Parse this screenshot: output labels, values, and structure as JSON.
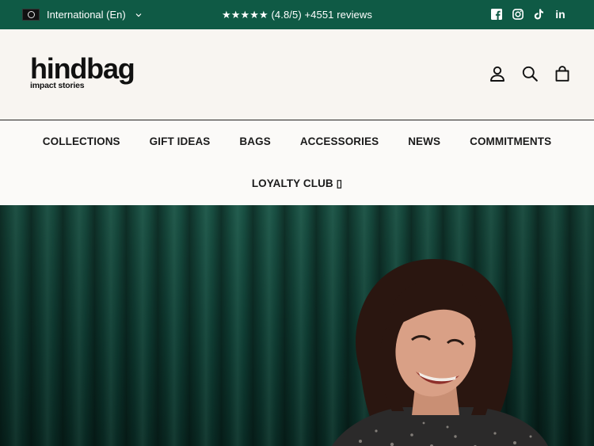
{
  "topbar": {
    "locale_label": "International (En)",
    "reviews_text": "★★★★★ (4.8/5) +4551 reviews",
    "social": [
      "facebook-icon",
      "instagram-icon",
      "tiktok-icon",
      "linkedin-icon"
    ],
    "linkedin_label": "in"
  },
  "header": {
    "logo_main": "hindbag",
    "logo_tag": "impact stories",
    "icons": [
      "account-icon",
      "search-icon",
      "cart-icon"
    ]
  },
  "nav": {
    "items": [
      "COLLECTIONS",
      "GIFT IDEAS",
      "BAGS",
      "ACCESSORIES",
      "NEWS",
      "COMMITMENTS"
    ],
    "loyalty": "LOYALTY CLUB ▯"
  },
  "colors": {
    "topbar_bg": "#0f5a45",
    "header_bg": "#f8f5f1",
    "nav_bg": "#fbfaf8",
    "hero_curtain": "#0f3f35"
  }
}
